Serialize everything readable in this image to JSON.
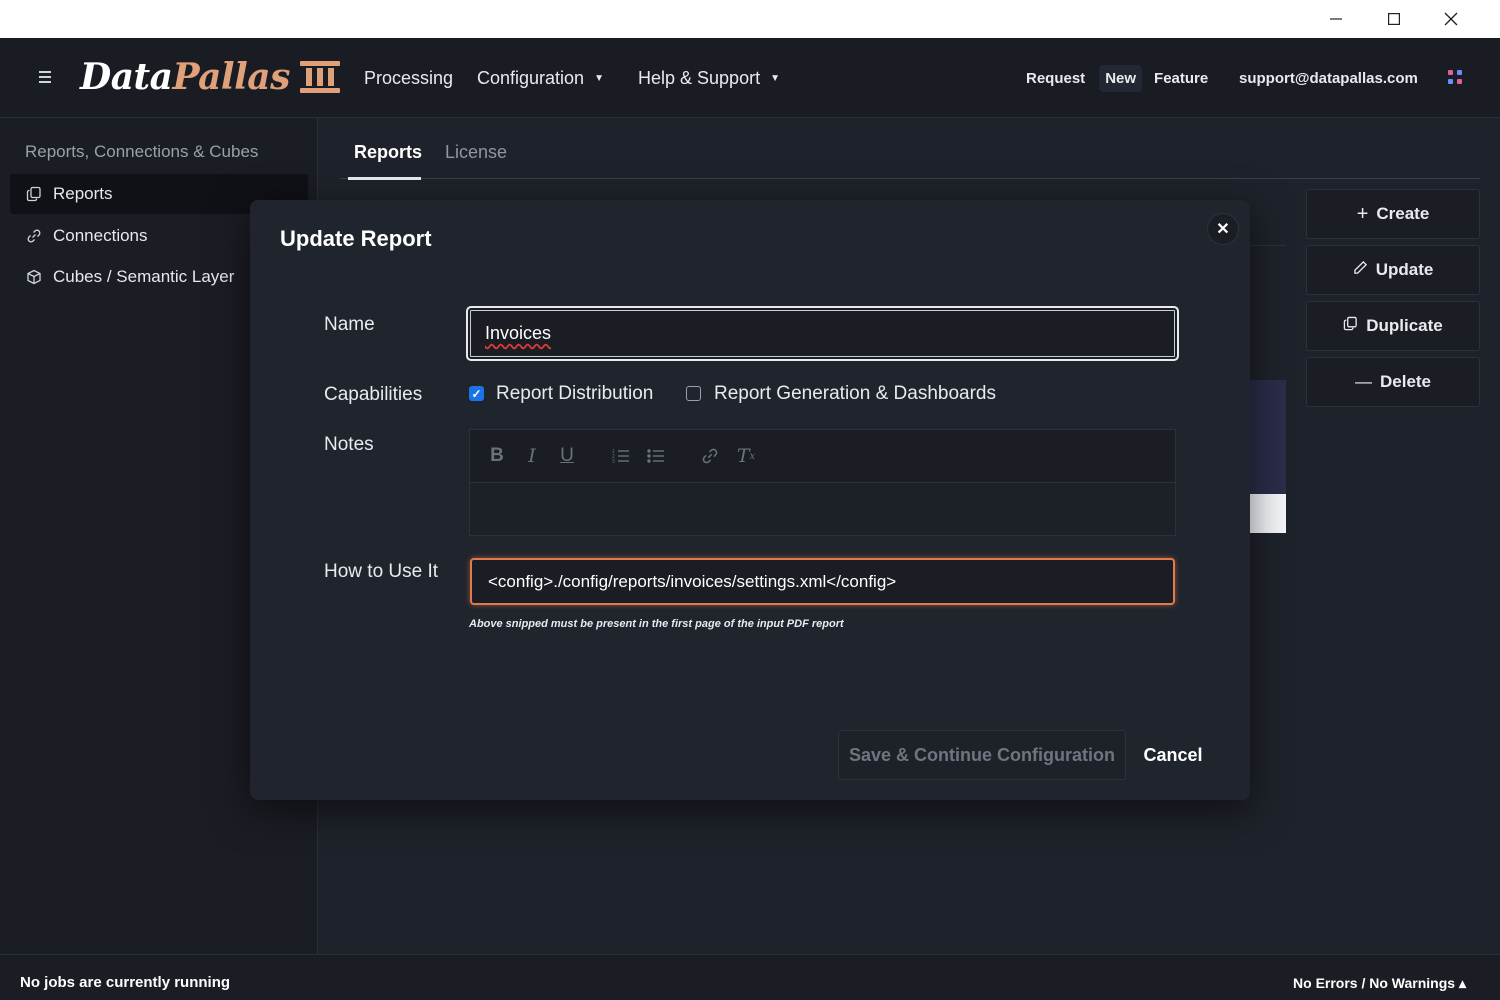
{
  "window": {
    "minimize_icon": "minimize-icon",
    "maximize_icon": "maximize-icon",
    "close_icon": "close-icon"
  },
  "header": {
    "logo_part1": "Data",
    "logo_part2": "Pallas",
    "nav": {
      "processing": "Processing",
      "configuration": "Configuration",
      "help_support": "Help & Support"
    },
    "request": "Request",
    "new": "New",
    "feature": "Feature",
    "support_email": "support@datapallas.com"
  },
  "sidebar": {
    "title": "Reports, Connections & Cubes",
    "items": [
      {
        "label": "Reports",
        "icon": "copy-icon"
      },
      {
        "label": "Connections",
        "icon": "link-icon"
      },
      {
        "label": "Cubes / Semantic Layer",
        "icon": "cube-icon"
      }
    ]
  },
  "tabs": {
    "reports": "Reports",
    "license": "License"
  },
  "actions": {
    "create": "Create",
    "update": "Update",
    "duplicate": "Duplicate",
    "delete": "Delete"
  },
  "modal": {
    "title": "Update Report",
    "name_label": "Name",
    "name_value": "Invoices",
    "capabilities_label": "Capabilities",
    "cap_distribution": "Report Distribution",
    "cap_distribution_checked": true,
    "cap_generation": "Report Generation & Dashboards",
    "cap_generation_checked": false,
    "notes_label": "Notes",
    "how_label": "How to Use It",
    "how_value": "<config>./config/reports/invoices/settings.xml</config>",
    "hint": "Above snipped must be present in the first page of the input PDF report",
    "save_button": "Save & Continue Configuration",
    "cancel_button": "Cancel"
  },
  "status": {
    "jobs": "No jobs are currently running",
    "errors": "No Errors / No Warnings ▴"
  },
  "colors": {
    "accent": "#e0a07a",
    "focus_orange": "#e07a4a",
    "checkbox_blue": "#1a73e8"
  }
}
